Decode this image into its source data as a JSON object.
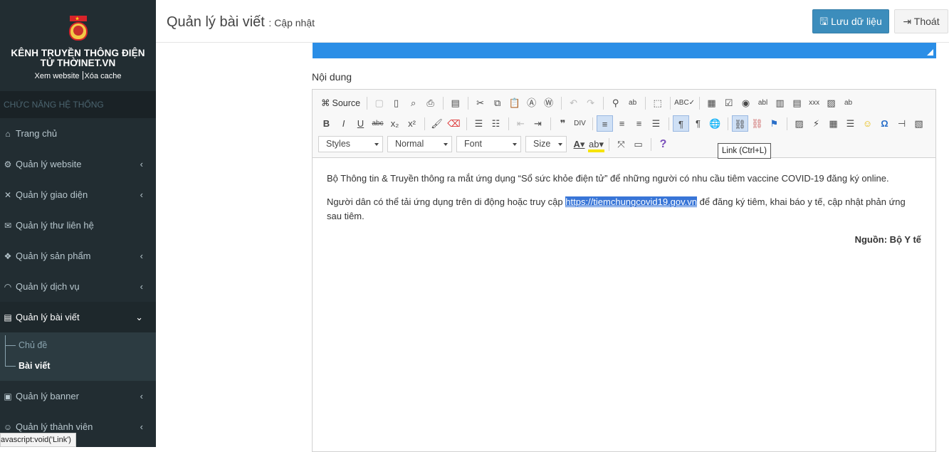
{
  "sidebar": {
    "brand": "KÊNH TRUYỀN THÔNG ĐIỆN TỬ THỜINET.VN",
    "view_site": "Xem website",
    "clear_cache": "Xóa cache",
    "section_header": "CHỨC NĂNG HỆ THỐNG",
    "items": [
      {
        "label": "Trang chủ",
        "icon": "home-icon"
      },
      {
        "label": "Quản lý website",
        "icon": "cogs-icon"
      },
      {
        "label": "Quản lý giao diện",
        "icon": "tools-icon"
      },
      {
        "label": "Quản lý thư liên hệ",
        "icon": "envelope-icon"
      },
      {
        "label": "Quản lý sản phẩm",
        "icon": "cubes-icon"
      },
      {
        "label": "Quản lý dịch vụ",
        "icon": "rss-icon"
      },
      {
        "label": "Quản lý bài viết",
        "icon": "newspaper-icon"
      },
      {
        "label": "Quản lý banner",
        "icon": "image-icon"
      },
      {
        "label": "Quản lý thành viên",
        "icon": "user-icon"
      }
    ],
    "submenu": [
      "Chủ đề",
      "Bài viết"
    ]
  },
  "status_tip": "avascript:void('Link')",
  "header": {
    "title": "Quản lý bài viết",
    "subtitle": ": Cập nhật",
    "save_label": "Lưu dữ liệu",
    "exit_label": "Thoát"
  },
  "form": {
    "content_label": "Nội dung"
  },
  "editor": {
    "source_label": "Source",
    "combos": {
      "styles": "Styles",
      "format": "Normal",
      "font": "Font",
      "size": "Size"
    },
    "tooltip": "Link (Ctrl+L)",
    "paragraph1": "Bộ Thông tin & Truyền thông ra mắt ứng dụng “Sổ sức khỏe điện tử” để những người có nhu cầu tiêm vaccine COVID-19 đăng ký online.",
    "paragraph2_before": "Người dân có thể tải ứng dụng trên di động hoặc truy cập ",
    "paragraph2_link": "https://tiemchungcovid19.gov.vn",
    "paragraph2_after": " để đăng ký tiêm, khai báo y tế, cập nhật phản ứng sau tiêm.",
    "source_credit": "Nguồn: Bộ Y tế"
  },
  "colors": {
    "sidebar_bg": "#222d32",
    "primary": "#3c8dbc",
    "bluebar": "#2b8ee6",
    "selection": "#3875d7"
  }
}
